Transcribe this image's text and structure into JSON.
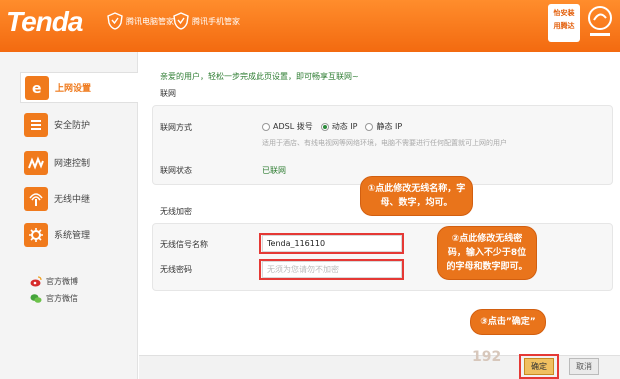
{
  "header": {
    "logo": "Tenda",
    "brand1": "腾讯电脑管家",
    "brand2": "腾讯手机管家",
    "badge_line1": "怡安装",
    "badge_line2": "用腾达"
  },
  "sidebar": {
    "items": [
      {
        "label": "上网设置",
        "icon": "internet-e-icon"
      },
      {
        "label": "安全防护",
        "icon": "shield-icon"
      },
      {
        "label": "网速控制",
        "icon": "speed-control-icon"
      },
      {
        "label": "无线中继",
        "icon": "wireless-repeater-icon"
      },
      {
        "label": "系统管理",
        "icon": "gear-icon"
      }
    ],
    "weibo": "官方微博",
    "wechat": "官方微信"
  },
  "main": {
    "welcome": "亲爱的用户，轻松一步完成此页设置，即可畅享互联网~",
    "section_internet": "联网",
    "connection_type_label": "联网方式",
    "options": [
      "ADSL 拨号",
      "动态 IP",
      "静态 IP"
    ],
    "selected_option": "动态 IP",
    "hint": "适用于酒店、有线电视网等网络环境，电脑不需要进行任何配置就可上网的用户",
    "status_label": "联网状态",
    "status_value": "已联网",
    "section_wireless": "无线加密",
    "ssid_label": "无线信号名称",
    "ssid_value": "Tenda_116110",
    "password_label": "无线密码",
    "password_placeholder": "无须为您请勿不加密",
    "ok": "确定",
    "cancel": "取消",
    "watermark": "192"
  },
  "annotations": {
    "callout1": "①点此修改无线名称，字母、数字，均可。",
    "callout2": "②点此修改无线密码，输入不少于8位的字母和数字即可。",
    "callout3": "③点击”确定”"
  },
  "colors": {
    "header_orange": "#f36a10",
    "accent": "#ef7a1d",
    "status_green": "#2e7d32",
    "highlight_red": "#e53935"
  }
}
